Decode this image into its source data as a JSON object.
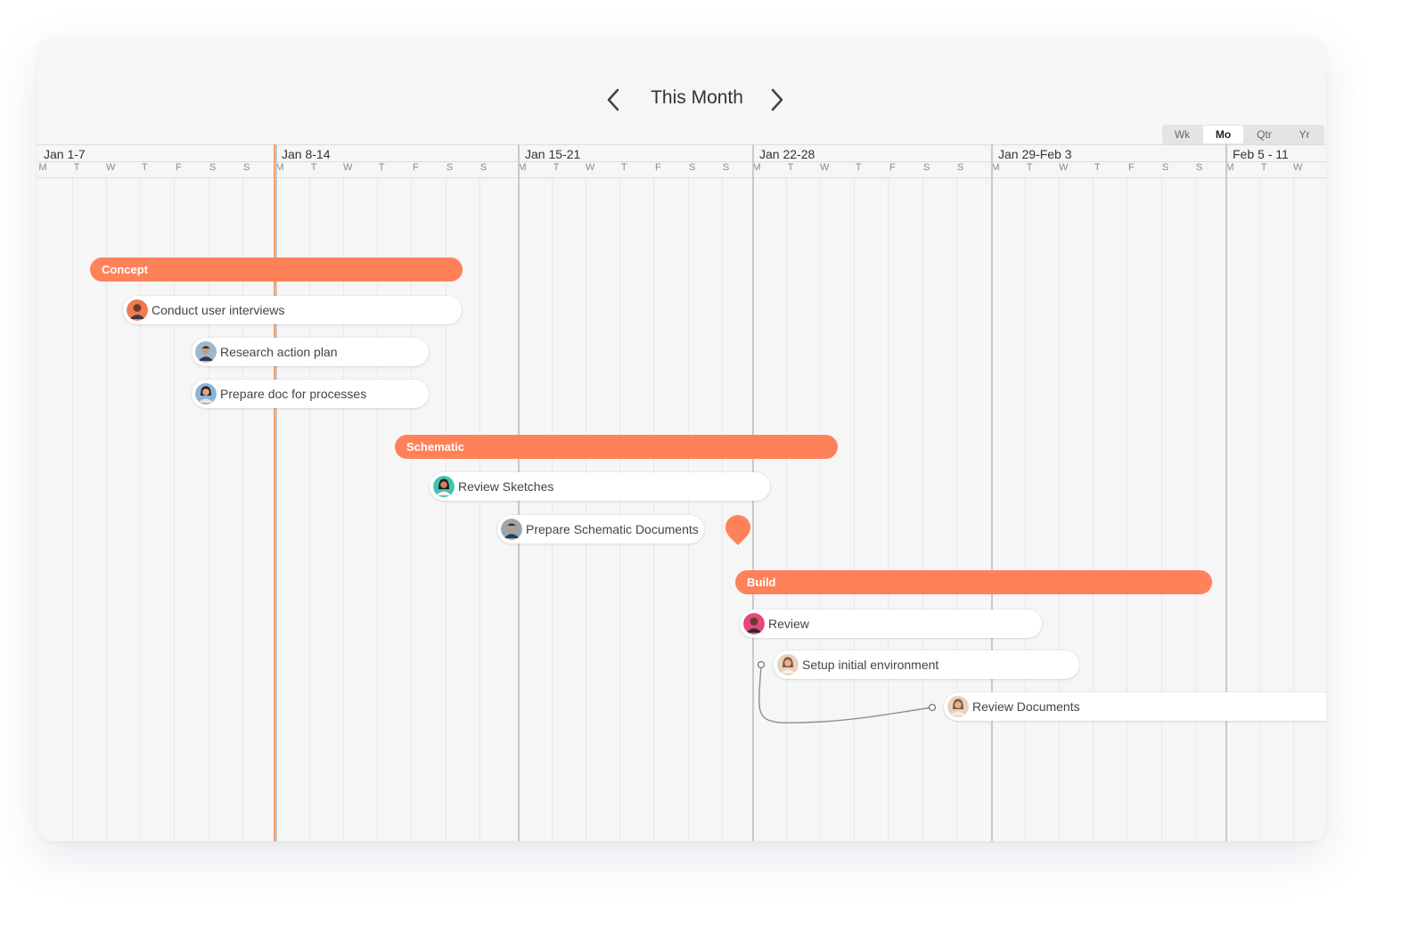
{
  "header": {
    "title": "This Month",
    "prev_icon": "chevron-left-icon",
    "next_icon": "chevron-right-icon"
  },
  "zoom": {
    "options": [
      "Wk",
      "Mo",
      "Qtr",
      "Yr"
    ],
    "selected": "Mo"
  },
  "weeks": [
    {
      "label": "Jan 1-7",
      "days": [
        "M",
        "T",
        "W",
        "T",
        "F",
        "S",
        "S"
      ]
    },
    {
      "label": "Jan 8-14",
      "days": [
        "M",
        "T",
        "W",
        "T",
        "F",
        "S",
        "S"
      ]
    },
    {
      "label": "Jan 15-21",
      "days": [
        "M",
        "T",
        "W",
        "T",
        "F",
        "S",
        "S"
      ]
    },
    {
      "label": "Jan 22-28",
      "days": [
        "M",
        "T",
        "W",
        "T",
        "F",
        "S",
        "S"
      ]
    },
    {
      "label": "Jan 29-Feb 3",
      "days": [
        "M",
        "T",
        "W",
        "T",
        "F",
        "S",
        "S"
      ]
    },
    {
      "label": "Feb 5 - 11",
      "days": [
        "M",
        "T",
        "W"
      ]
    }
  ],
  "colors": {
    "accent": "#ff8159",
    "today_line": "#f4a070",
    "background": "#f6f6f6"
  },
  "phases": [
    {
      "label": "Concept"
    },
    {
      "label": "Schematic"
    },
    {
      "label": "Build"
    }
  ],
  "tasks": [
    {
      "label": "Conduct user interviews",
      "avatar": "avatar-orange"
    },
    {
      "label": "Research action plan",
      "avatar": "avatar-blue"
    },
    {
      "label": "Prepare doc for processes",
      "avatar": "avatar-blue"
    },
    {
      "label": "Review Sketches",
      "avatar": "avatar-teal"
    },
    {
      "label": "Prepare Schematic Documents",
      "avatar": "avatar-grey"
    },
    {
      "label": "Review",
      "avatar": "avatar-pink"
    },
    {
      "label": "Setup initial environment",
      "avatar": "avatar-beige"
    },
    {
      "label": "Review Documents",
      "avatar": "avatar-beige"
    }
  ],
  "milestone": {
    "icon": "milestone-marker-icon"
  }
}
